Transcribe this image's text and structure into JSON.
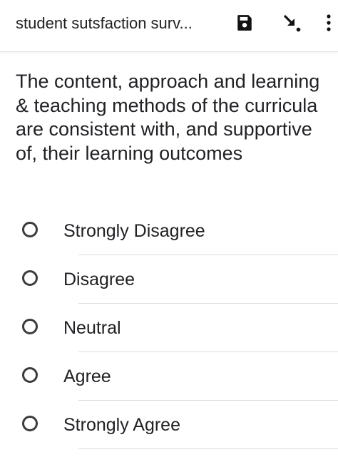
{
  "app_bar": {
    "title": "student sutsfaction surv...",
    "icons": [
      "save-icon",
      "drill-down-arrow-icon",
      "more-vert-icon"
    ]
  },
  "question": {
    "text": "The content, approach and learning & teaching methods of the curricula are consistent with, and supportive of, their learning outcomes"
  },
  "options": [
    {
      "label": "Strongly Disagree",
      "selected": false
    },
    {
      "label": "Disagree",
      "selected": false
    },
    {
      "label": "Neutral",
      "selected": false
    },
    {
      "label": "Agree",
      "selected": false
    },
    {
      "label": "Strongly Agree",
      "selected": false
    }
  ],
  "colors": {
    "text": "#202124",
    "radio_outline": "#3c3c3c",
    "divider": "#dadce0",
    "icon": "#111111"
  }
}
